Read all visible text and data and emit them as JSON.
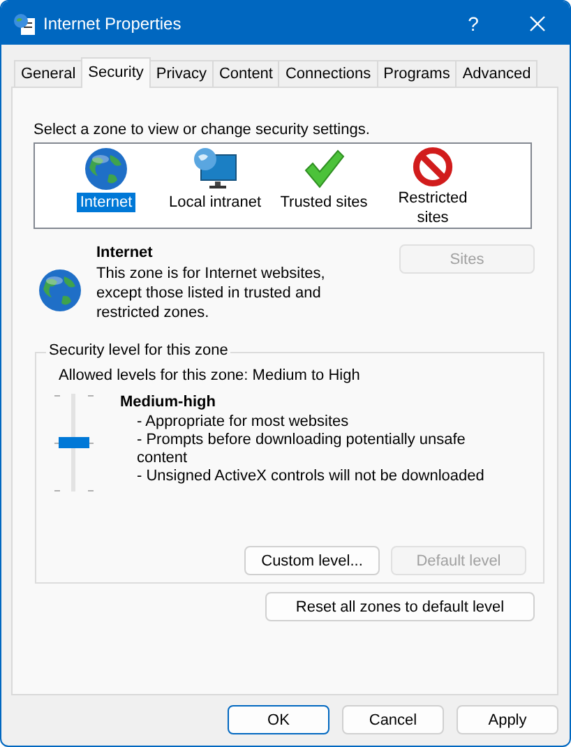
{
  "window": {
    "title": "Internet Properties",
    "help": "?"
  },
  "tabs": [
    {
      "label": "General",
      "selected": false
    },
    {
      "label": "Security",
      "selected": true
    },
    {
      "label": "Privacy",
      "selected": false
    },
    {
      "label": "Content",
      "selected": false
    },
    {
      "label": "Connections",
      "selected": false
    },
    {
      "label": "Programs",
      "selected": false
    },
    {
      "label": "Advanced",
      "selected": false
    }
  ],
  "zone_prompt": "Select a zone to view or change security settings.",
  "zones": [
    {
      "kind": "globe",
      "label": "Internet",
      "selected": true
    },
    {
      "kind": "intranet",
      "label": "Local intranet",
      "selected": false
    },
    {
      "kind": "trusted",
      "label": "Trusted sites",
      "selected": false
    },
    {
      "kind": "restricted",
      "label": "Restricted sites",
      "selected": false
    }
  ],
  "zone_info": {
    "kind": "globe",
    "title": "Internet",
    "description": "This zone is for Internet websites, except those listed in trusted and restricted zones.",
    "button": {
      "label": "Sites",
      "disabled": true
    }
  },
  "security_level": {
    "legend": "Security level for this zone",
    "allowed": "Allowed levels for this zone: Medium to High",
    "level": 0.5,
    "name": "Medium-high",
    "bullets": [
      "- Appropriate for most websites",
      "- Prompts before downloading potentially unsafe content",
      "- Unsigned ActiveX controls will not be downloaded"
    ],
    "buttons": [
      {
        "label": "Custom level...",
        "disabled": false
      },
      {
        "label": "Default level",
        "disabled": true
      }
    ]
  },
  "reset_button": {
    "label": "Reset all zones to default level",
    "disabled": false
  },
  "dialog_buttons": [
    {
      "label": "OK",
      "default": true,
      "disabled": false
    },
    {
      "label": "Cancel",
      "default": false,
      "disabled": false
    },
    {
      "label": "Apply",
      "default": false,
      "disabled": false
    }
  ]
}
